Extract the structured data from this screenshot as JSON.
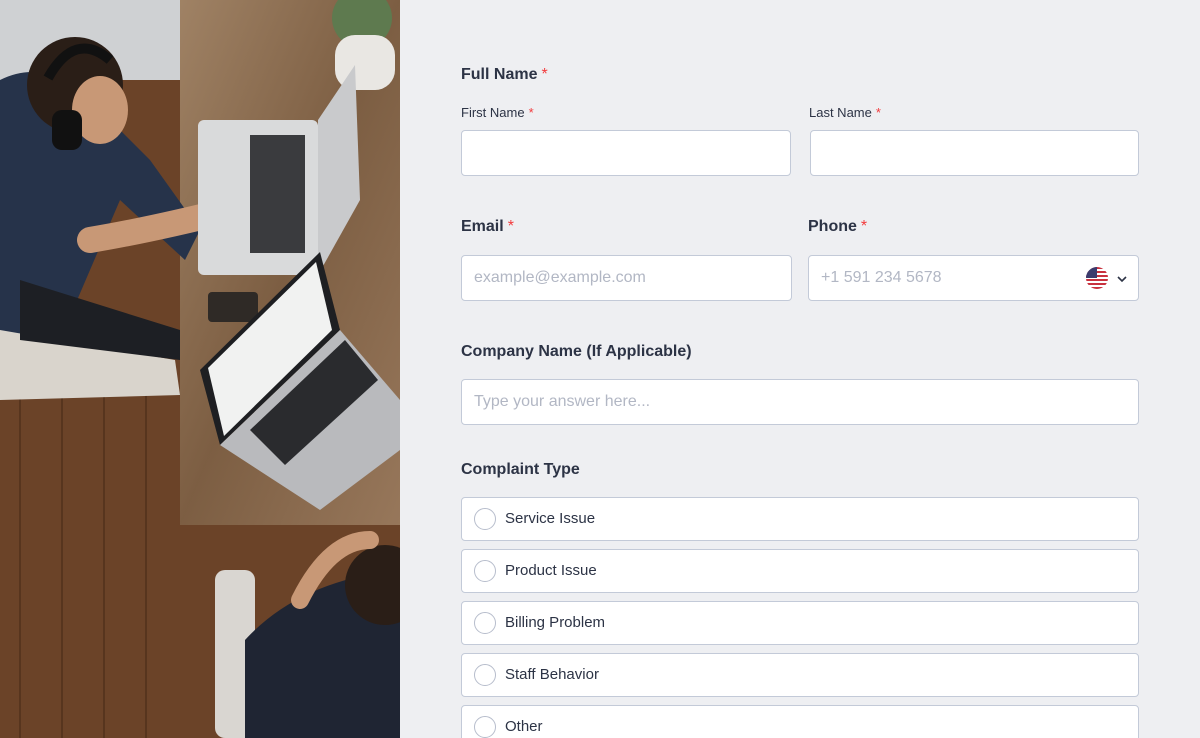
{
  "form": {
    "full_name": {
      "label": "Full Name",
      "required": "*"
    },
    "first_name": {
      "label": "First Name",
      "required": "*",
      "value": ""
    },
    "last_name": {
      "label": "Last Name",
      "required": "*",
      "value": ""
    },
    "email": {
      "label": "Email",
      "required": "*",
      "placeholder": "example@example.com",
      "value": ""
    },
    "phone": {
      "label": "Phone",
      "required": "*",
      "placeholder": "+1 591 234 5678",
      "value": "",
      "country_icon": "us-flag-icon"
    },
    "company": {
      "label": "Company Name (If Applicable)",
      "placeholder": "Type your answer here...",
      "value": ""
    },
    "complaint_type": {
      "label": "Complaint Type",
      "options": [
        "Service Issue",
        "Product Issue",
        "Billing Problem",
        "Staff Behavior",
        "Other"
      ]
    }
  },
  "colors": {
    "required": "#f23a3c",
    "text": "#2c3345",
    "background": "#eeeff2",
    "border": "#c3cad8"
  }
}
